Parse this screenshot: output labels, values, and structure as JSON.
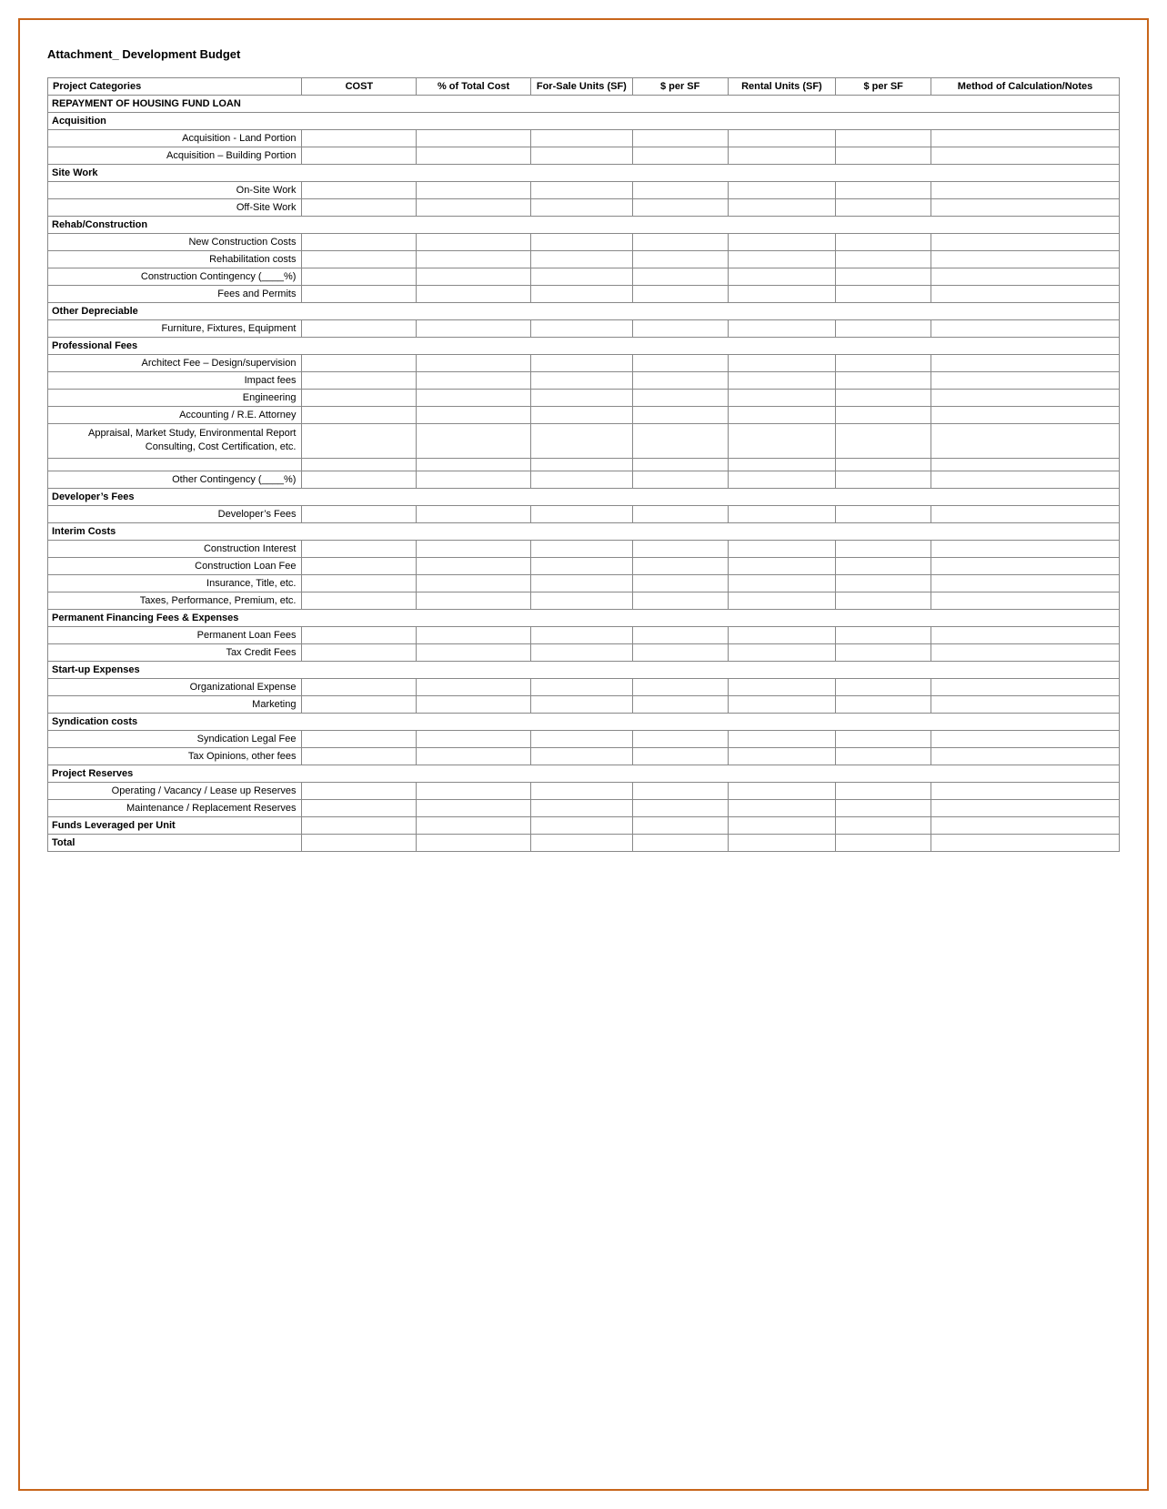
{
  "page": {
    "title": "Attachment_ Development Budget",
    "table": {
      "headers": {
        "project_categories": "Project Categories",
        "cost": "COST",
        "pct_total_cost": "% of Total Cost",
        "for_sale_units": "For-Sale Units (SF)",
        "per_sf_1": "$ per SF",
        "rental_units": "Rental Units (SF)",
        "per_sf_2": "$ per SF",
        "method": "Method of Calculation/Notes"
      },
      "rows": [
        {
          "type": "section",
          "label": "REPAYMENT OF HOUSING FUND LOAN"
        },
        {
          "type": "section",
          "label": "Acquisition"
        },
        {
          "type": "item",
          "label": "Acquisition - Land Portion"
        },
        {
          "type": "item",
          "label": "Acquisition – Building Portion"
        },
        {
          "type": "section",
          "label": "Site Work"
        },
        {
          "type": "item",
          "label": "On-Site Work"
        },
        {
          "type": "item",
          "label": "Off-Site Work"
        },
        {
          "type": "section",
          "label": "Rehab/Construction"
        },
        {
          "type": "item",
          "label": "New Construction Costs"
        },
        {
          "type": "item",
          "label": "Rehabilitation costs"
        },
        {
          "type": "item",
          "label": "Construction Contingency (____%)",
          "multiline": true
        },
        {
          "type": "item",
          "label": "Fees and Permits"
        },
        {
          "type": "section",
          "label": "Other Depreciable"
        },
        {
          "type": "item",
          "label": "Furniture, Fixtures, Equipment"
        },
        {
          "type": "section",
          "label": "Professional Fees"
        },
        {
          "type": "item",
          "label": "Architect Fee – Design/supervision",
          "multiline": true
        },
        {
          "type": "item",
          "label": "Impact fees"
        },
        {
          "type": "item",
          "label": "Engineering"
        },
        {
          "type": "item",
          "label": "Accounting / R.E. Attorney"
        },
        {
          "type": "item",
          "label": "Appraisal, Market Study, Environmental Report Consulting, Cost Certification, etc.",
          "multiline3": true
        },
        {
          "type": "item-spacer"
        },
        {
          "type": "item",
          "label": "Other Contingency (____%)"
        },
        {
          "type": "section",
          "label": "Developer’s Fees"
        },
        {
          "type": "item",
          "label": "Developer’s Fees"
        },
        {
          "type": "section",
          "label": "Interim Costs"
        },
        {
          "type": "item",
          "label": "Construction Interest"
        },
        {
          "type": "item",
          "label": "Construction Loan Fee"
        },
        {
          "type": "item",
          "label": "Insurance, Title, etc."
        },
        {
          "type": "item",
          "label": "Taxes, Performance, Premium, etc.",
          "multiline": true
        },
        {
          "type": "section",
          "label": "Permanent Financing Fees & Expenses"
        },
        {
          "type": "item",
          "label": "Permanent Loan Fees"
        },
        {
          "type": "item",
          "label": "Tax Credit Fees"
        },
        {
          "type": "section",
          "label": "Start-up Expenses"
        },
        {
          "type": "item",
          "label": "Organizational Expense"
        },
        {
          "type": "item",
          "label": "Marketing"
        },
        {
          "type": "section",
          "label": "Syndication costs"
        },
        {
          "type": "item",
          "label": "Syndication Legal Fee"
        },
        {
          "type": "item",
          "label": "Tax Opinions, other fees"
        },
        {
          "type": "section",
          "label": "Project Reserves"
        },
        {
          "type": "item",
          "label": "Operating / Vacancy /  Lease up Reserves",
          "multiline": true
        },
        {
          "type": "item",
          "label": "Maintenance / Replacement Reserves",
          "multiline": true
        },
        {
          "type": "bold-row",
          "label": "Funds Leveraged per Unit"
        },
        {
          "type": "bold-row",
          "label": "Total"
        }
      ]
    }
  }
}
